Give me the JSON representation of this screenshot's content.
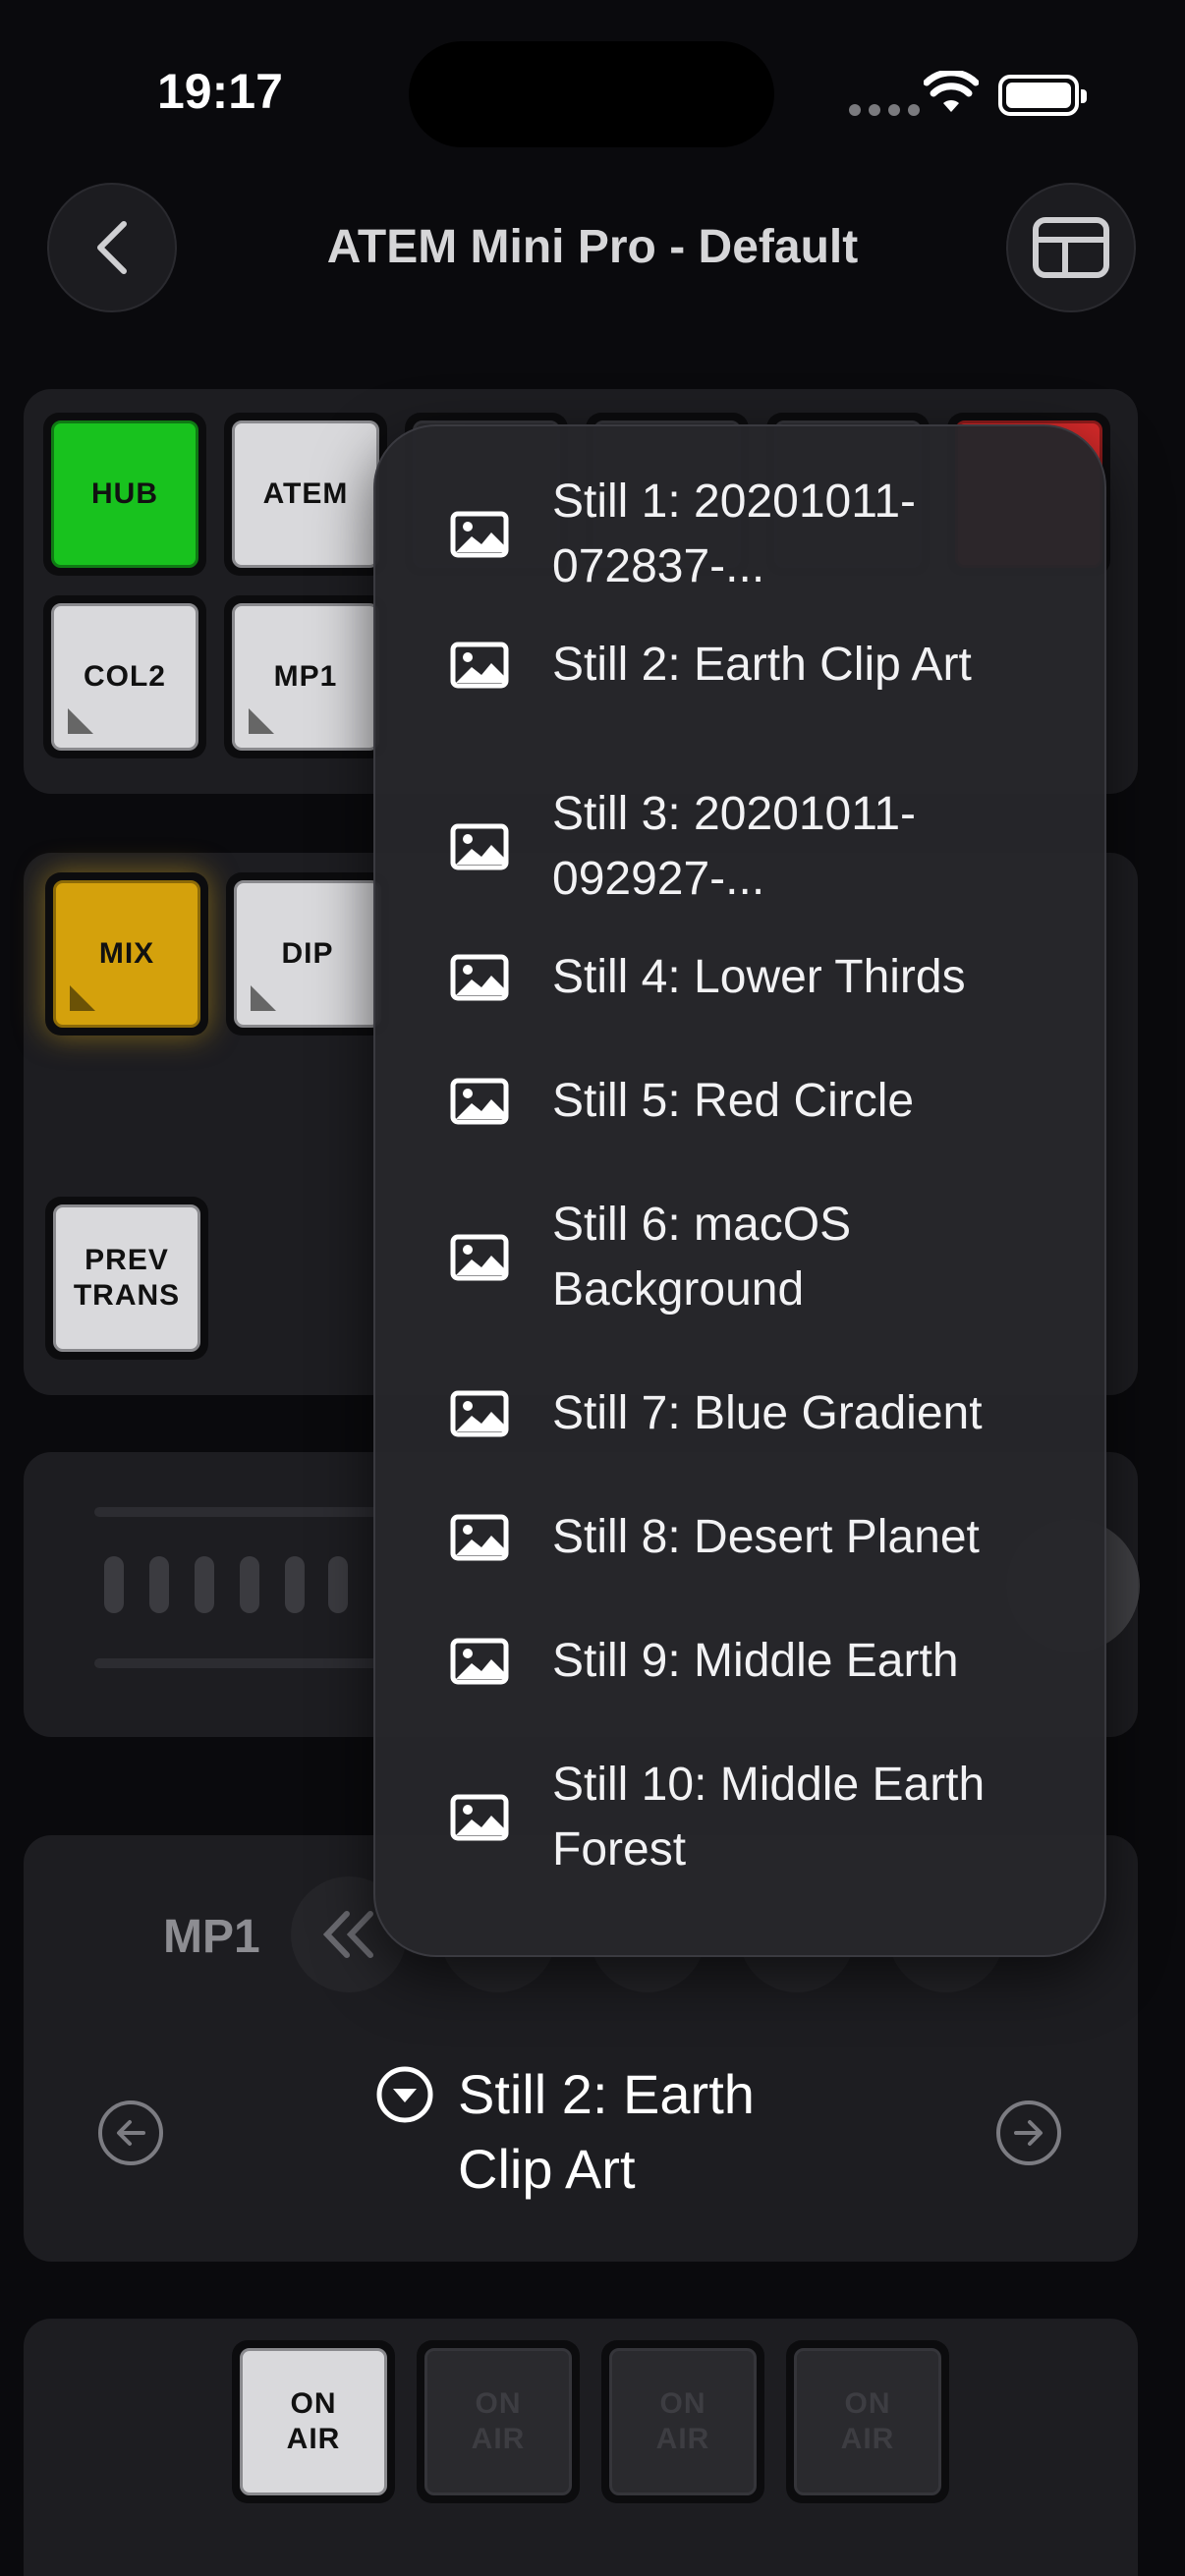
{
  "status": {
    "time": "19:17"
  },
  "header": {
    "title": "ATEM Mini Pro - Default"
  },
  "sources": {
    "row1": [
      "HUB",
      "ATEM"
    ],
    "row2": [
      "COL2",
      "MP1"
    ]
  },
  "transitions": {
    "mix": "MIX",
    "dip": "DIP",
    "prev_trans_1": "PREV",
    "prev_trans_2": "TRANS"
  },
  "media_player": {
    "label": "MP1",
    "selected": "Still 2: Earth Clip Art"
  },
  "stills_menu": [
    "Still 1: 20201011-072837-...",
    "Still 2: Earth Clip Art",
    "Still 3: 20201011-092927-...",
    "Still 4: Lower Thirds",
    "Still 5: Red Circle",
    "Still 6: macOS Background",
    "Still 7: Blue Gradient",
    "Still 8: Desert Planet",
    "Still 9: Middle Earth",
    "Still 10: Middle Earth Forest"
  ],
  "on_air": {
    "line1": "ON",
    "line2": "AIR"
  },
  "colors": {
    "green": "#18c21e",
    "yellow": "#d4a10c",
    "red": "#d62a2a"
  }
}
